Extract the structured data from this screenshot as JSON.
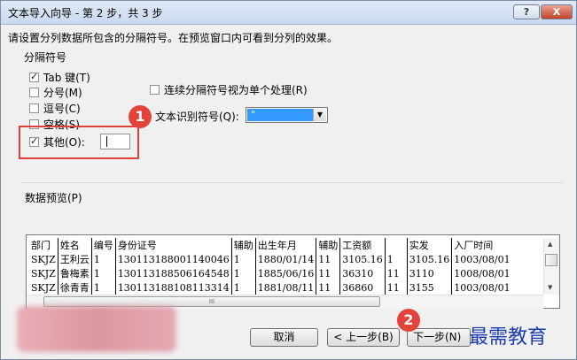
{
  "window": {
    "title": "文本导入向导 - 第 2 步，共 3 步",
    "help_label": "?",
    "close_label": "X"
  },
  "instruction": "请设置分列数据所包含的分隔符号。在预览窗口内可看到分列的效果。",
  "delimiters": {
    "group_title": "分隔符号",
    "items": [
      {
        "label": "Tab 键(T)",
        "checked": true
      },
      {
        "label": "分号(M)",
        "checked": false
      },
      {
        "label": "逗号(C)",
        "checked": false
      },
      {
        "label": "空格(S)",
        "checked": false
      },
      {
        "label": "其他(O):",
        "checked": true
      }
    ],
    "other_value": ""
  },
  "consecutive": {
    "label": "连续分隔符号视为单个处理(R)",
    "checked": false
  },
  "text_qualifier": {
    "label": "文本识别符号(Q):",
    "value": "\""
  },
  "preview": {
    "label": "数据预览(P)",
    "rows": [
      [
        "部门",
        "姓名",
        "编号",
        "身份证号",
        "辅助",
        "出生年月",
        "辅助",
        "工资额",
        "",
        "实发",
        "入厂时间"
      ],
      [
        "SKJZ",
        "王利云",
        "1",
        "130113188001140046",
        "1",
        "1880/01/14",
        "11",
        "3105.16",
        "1",
        "3105.16",
        "1003/08/01"
      ],
      [
        "SKJZ",
        "鲁梅素",
        "1",
        "130113188506164548",
        "1",
        "1885/06/16",
        "11",
        "36310",
        "11",
        "3110",
        "1008/08/01"
      ],
      [
        "SKJZ",
        "徐青青",
        "1",
        "130113188108113314",
        "1",
        "1881/08/11",
        "11",
        "36860",
        "11",
        "3155",
        "1003/08/01"
      ]
    ],
    "hscroll_grip": "III"
  },
  "buttons": {
    "cancel": "取消",
    "back": "< 上一步(B)",
    "next": "下一步(N) >"
  },
  "badges": {
    "one": "1",
    "two": "2"
  },
  "watermark": "最需教育"
}
